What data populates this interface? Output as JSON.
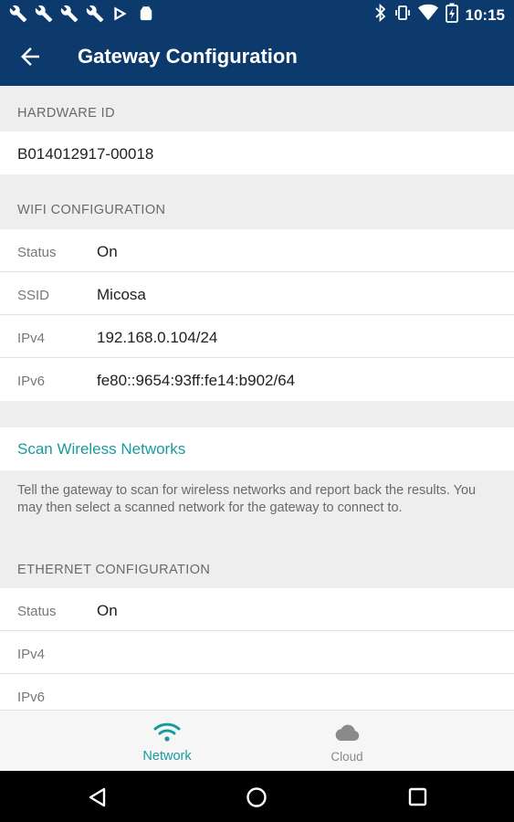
{
  "status_bar": {
    "time": "10:15",
    "notification_icons": [
      "wrench-icon",
      "wrench-icon",
      "wrench-icon",
      "wrench-icon",
      "play-store-icon",
      "android-icon"
    ]
  },
  "app_bar": {
    "title": "Gateway Configuration"
  },
  "hardware": {
    "header": "HARDWARE ID",
    "id": "B014012917-00018"
  },
  "wifi": {
    "header": "WIFI CONFIGURATION",
    "rows": [
      {
        "label": "Status",
        "value": "On"
      },
      {
        "label": "SSID",
        "value": "Micosa"
      },
      {
        "label": "IPv4",
        "value": "192.168.0.104/24"
      },
      {
        "label": "IPv6",
        "value": "fe80::9654:93ff:fe14:b902/64"
      }
    ],
    "scan_label": "Scan Wireless Networks",
    "scan_description": "Tell the gateway to scan for wireless networks and report back the results. You may then select a scanned network for the gateway to connect to."
  },
  "ethernet": {
    "header": "ETHERNET CONFIGURATION",
    "rows": [
      {
        "label": "Status",
        "value": "On"
      },
      {
        "label": "IPv4",
        "value": ""
      },
      {
        "label": "IPv6",
        "value": ""
      }
    ]
  },
  "bottom_nav": {
    "items": [
      {
        "label": "Network",
        "icon": "wifi-icon",
        "active": true
      },
      {
        "label": "Cloud",
        "icon": "cloud-icon",
        "active": false
      }
    ]
  },
  "colors": {
    "primary": "#0c3a6d",
    "accent": "#1a9aa0",
    "background": "#eeeeee"
  }
}
